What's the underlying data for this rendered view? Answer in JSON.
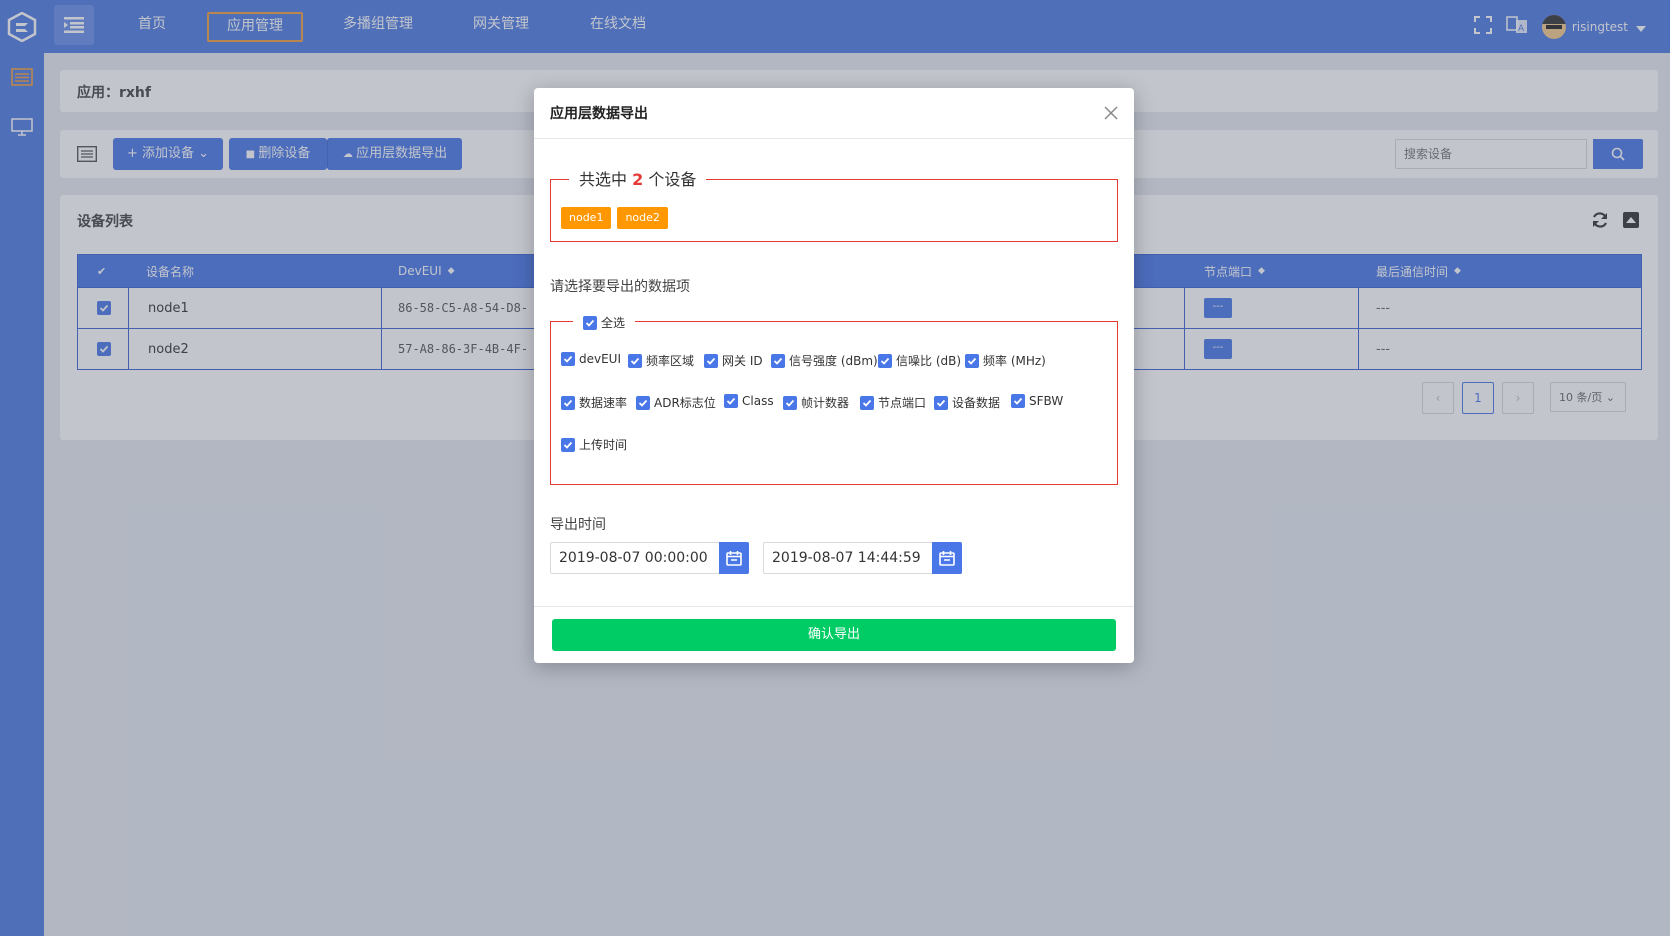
{
  "nav": {
    "items": [
      "首页",
      "应用管理",
      "多播组管理",
      "网关管理",
      "在线文档"
    ],
    "active_index": 1,
    "username": "risingtest"
  },
  "app_header": {
    "label": "应用：rxhf"
  },
  "toolbar": {
    "add_device": "添加设备",
    "delete_device": "删除设备",
    "export_data": "应用层数据导出",
    "search_placeholder": "搜索设备"
  },
  "device_list": {
    "title": "设备列表",
    "columns": [
      "设备名称",
      "DevEUI",
      "节点端口",
      "最后通信时间"
    ],
    "rows": [
      {
        "name": "node1",
        "deveui": "86-58-C5-A8-54-D8-",
        "port": "---",
        "last_seen": "---"
      },
      {
        "name": "node2",
        "deveui": "57-A8-86-3F-4B-4F-",
        "port": "---",
        "last_seen": "---"
      }
    ],
    "page": "1",
    "page_size": "10 条/页"
  },
  "modal": {
    "title": "应用层数据导出",
    "selected_prefix": "共选中",
    "selected_count": "2",
    "selected_suffix": "个设备",
    "tags": [
      "node1",
      "node2"
    ],
    "choose_label": "请选择要导出的数据项",
    "select_all": "全选",
    "options": [
      "devEUI",
      "频率区域",
      "网关 ID",
      "信号强度 (dBm)",
      "信噪比 (dB)",
      "频率 (MHz)",
      "数据速率",
      "ADR标志位",
      "Class",
      "帧计数器",
      "节点端口",
      "设备数据",
      "SFBW",
      "上传时间"
    ],
    "time_label": "导出时间",
    "start_time": "2019-08-07 00:00:00",
    "end_time": "2019-08-07 14:44:59",
    "confirm": "确认导出"
  },
  "colors": {
    "primary": "#4a77e7",
    "accent": "#f1a03c",
    "danger": "#e53935",
    "success": "#00cc66",
    "tag": "#ff9800"
  }
}
